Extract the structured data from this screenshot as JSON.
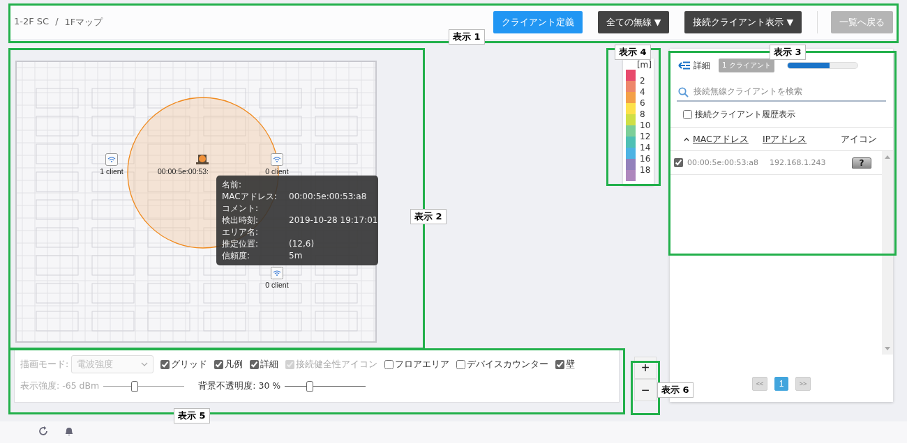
{
  "breadcrumb": {
    "items": [
      "1-2F SC",
      "1Fマップ"
    ],
    "separator": "/"
  },
  "toolbar": [
    {
      "label": "クライアント定義",
      "kind": "primary"
    },
    {
      "label": "全ての無線 ▼",
      "kind": "dark"
    },
    {
      "label": "接続クライアント表示 ▼",
      "kind": "dark"
    },
    {
      "label": "一覧へ戻る",
      "kind": "disabled"
    }
  ],
  "map": {
    "access_points": [
      {
        "label": "1 client"
      },
      {
        "label": "0 client"
      },
      {
        "label": "0 client"
      }
    ],
    "client": {
      "label": "00:00:5e:00:53:"
    },
    "tooltip": [
      {
        "label": "名前:"
      },
      {
        "label": "MACアドレス:",
        "value": "00:00:5e:00:53:a8"
      },
      {
        "label": "コメント:"
      },
      {
        "label": "検出時刻:",
        "value": "2019-10-28 19:17:01"
      },
      {
        "label": "エリア名:"
      },
      {
        "label": "推定位置:",
        "value": "(12,6)"
      },
      {
        "label": "信頼度:",
        "value": "5m"
      }
    ]
  },
  "legend": {
    "unit": "[m]",
    "swatches": [
      {
        "color": "#e84a6c"
      },
      {
        "color": "#ee866a"
      },
      {
        "color": "#f4a047"
      },
      {
        "color": "#fde14a"
      },
      {
        "color": "#cfdf46"
      },
      {
        "color": "#7ccf99"
      },
      {
        "color": "#4ec0b5"
      },
      {
        "color": "#4db3e3"
      },
      {
        "color": "#9281bb"
      },
      {
        "color": "#ae87bd"
      }
    ],
    "ticks": [
      "2",
      "4",
      "6",
      "8",
      "10",
      "12",
      "14",
      "16",
      "18"
    ]
  },
  "controls": {
    "draw_mode": {
      "label": "描画モード:",
      "value": "電波強度",
      "disabled": true
    },
    "checkboxes": [
      {
        "label": "グリッド",
        "checked": true,
        "disabled": false
      },
      {
        "label": "凡例",
        "checked": true,
        "disabled": false
      },
      {
        "label": "詳細",
        "checked": true,
        "disabled": false
      },
      {
        "label": "接続健全性アイコン",
        "checked": true,
        "disabled": true
      },
      {
        "label": "フロアエリア",
        "checked": false,
        "disabled": false
      },
      {
        "label": "デバイスカウンター",
        "checked": false,
        "disabled": false
      },
      {
        "label": "壁",
        "checked": true,
        "disabled": false
      }
    ],
    "sliders": [
      {
        "label": "表示強度: -65 dBm",
        "level": 0.38,
        "disabled": true
      },
      {
        "label": "背景不透明度: 30 %",
        "level": 0.3,
        "disabled": false
      }
    ]
  },
  "zoom": [
    "+",
    "−"
  ],
  "details": {
    "title": "詳細",
    "badge": "1 クライアント",
    "progress": {
      "level": 0.6
    },
    "search": {
      "placeholder": "接続無線クライアントを検索"
    },
    "history": {
      "label": "接続クライアント履歴表示",
      "checked": false
    },
    "columns": [
      {
        "label": "MACアドレス",
        "sortable": true,
        "sorted": true
      },
      {
        "label": "IPアドレス",
        "sortable": true,
        "sorted": false
      },
      {
        "label": "アイコン",
        "sortable": false,
        "sorted": false
      }
    ],
    "rows": [
      {
        "checked": true,
        "mac": "00:00:5e:00:53:a8",
        "ip": "192.168.1.243",
        "icon": "?"
      }
    ],
    "pagination": {
      "prev": "<<",
      "pages": [
        {
          "label": "1",
          "selected": true
        }
      ],
      "next": ">>"
    }
  },
  "annotations": [
    "表示 1",
    "表示 2",
    "表示 3",
    "表示 4",
    "表示 5",
    "表示 6"
  ]
}
